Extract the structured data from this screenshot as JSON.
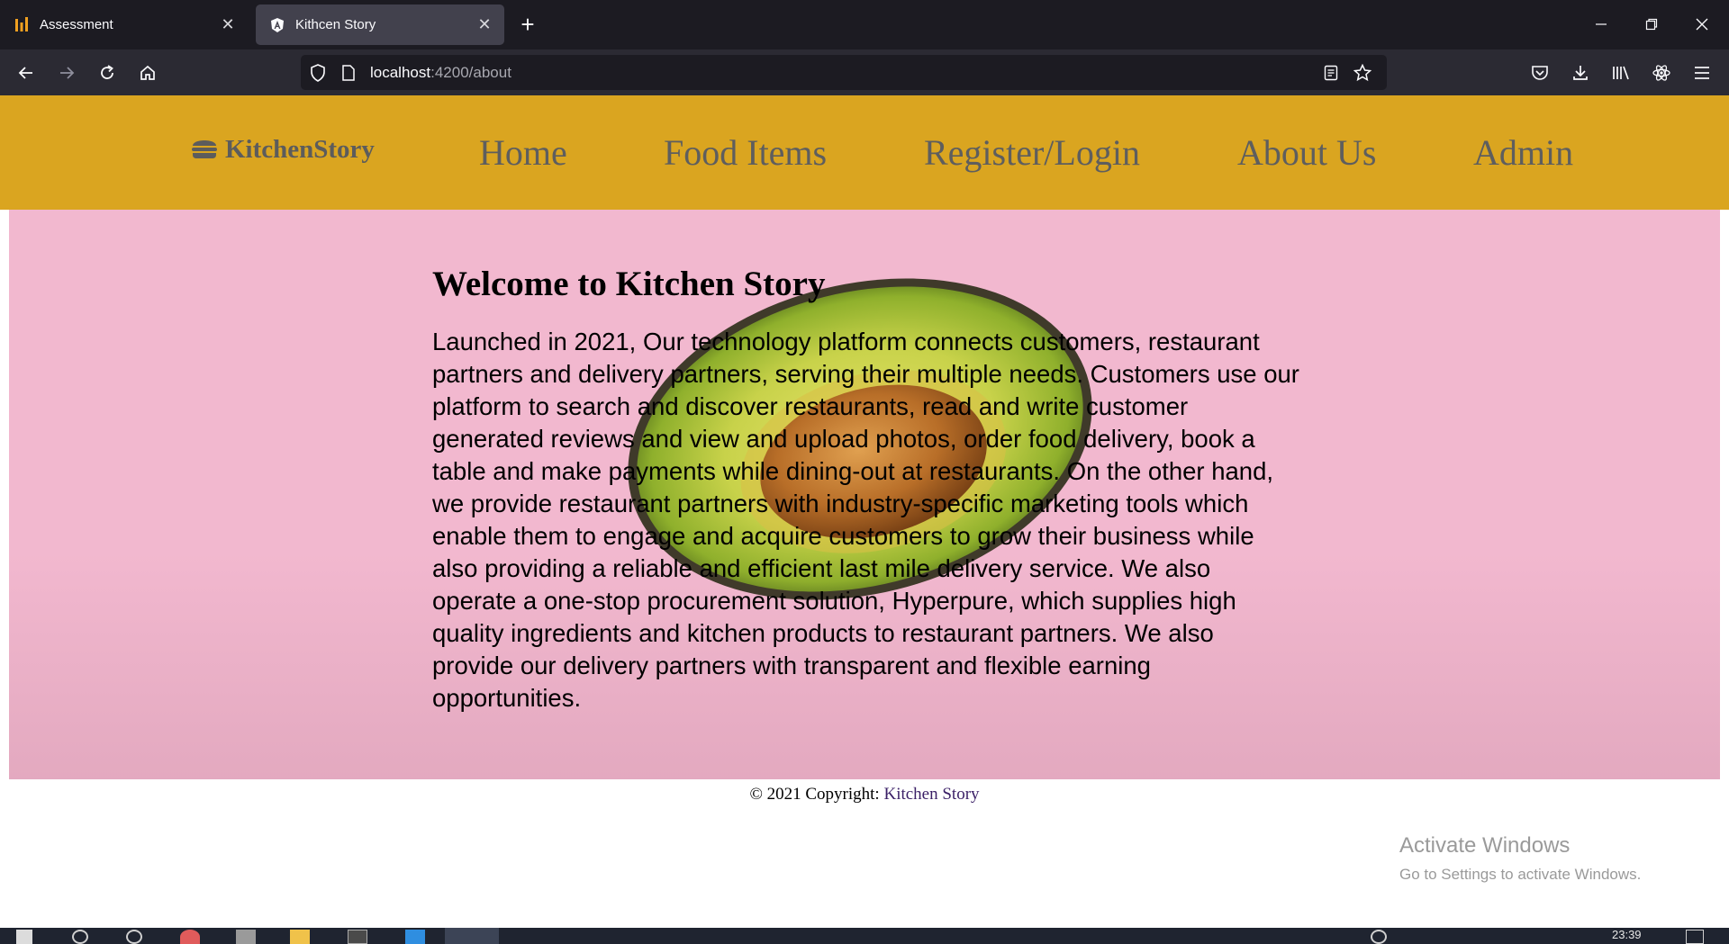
{
  "browser": {
    "tabs": [
      {
        "title": "Assessment",
        "active": false,
        "icon": "assessment-favicon"
      },
      {
        "title": "Kithcen Story",
        "active": true,
        "icon": "angular-favicon"
      }
    ],
    "url_host": "localhost",
    "url_path": ":4200/about"
  },
  "header": {
    "brand": "KitchenStory",
    "brand_icon": "burger-icon",
    "menu": [
      "Home",
      "Food Items",
      "Register/Login",
      "About Us",
      "Admin"
    ]
  },
  "main": {
    "heading": "Welcome to Kitchen Story",
    "body": "Launched in 2021, Our technology platform connects customers, restaurant partners and delivery partners, serving their multiple needs. Customers use our platform to search and discover restaurants, read and write customer generated reviews and view and upload photos, order food delivery, book a table and make payments while dining-out at restaurants. On the other hand, we provide restaurant partners with industry-specific marketing tools which enable them to engage and acquire customers to grow their business while also providing a reliable and efficient last mile delivery service. We also operate a one-stop procurement solution, Hyperpure, which supplies high quality ingredients and kitchen products to restaurant partners. We also provide our delivery partners with transparent and flexible earning opportunities."
  },
  "footer": {
    "copyright": "© 2021 Copyright:",
    "brand_link": "Kitchen Story"
  },
  "watermark": {
    "line1": "Activate Windows",
    "line2": "Go to Settings to activate Windows."
  },
  "taskbar": {
    "time": "23:39"
  },
  "colors": {
    "header_bg": "#daa520",
    "hero_bg": "#f2b8cf",
    "footer_link": "#3a1f66"
  }
}
